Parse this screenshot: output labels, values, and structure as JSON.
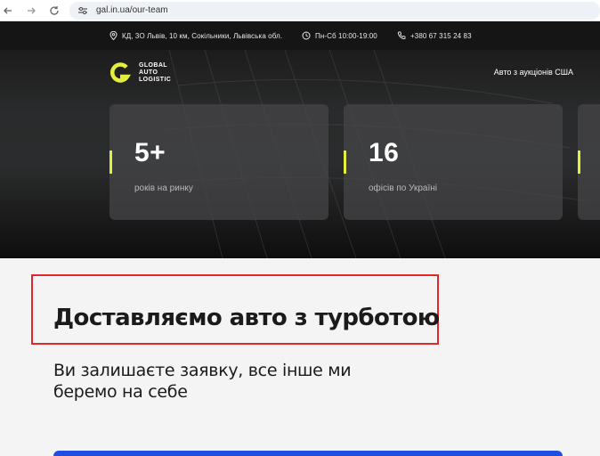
{
  "browser": {
    "url": "gal.in.ua/our-team"
  },
  "topbar": {
    "address": "КД, 3О Львів, 10 км, Сокільники, Львівська обл.",
    "hours": "Пн-Сб 10:00-19:00",
    "phone": "+380 67 315 24 83"
  },
  "header": {
    "logo_letter": "G",
    "logo_lines": [
      "GLOBAL",
      "AUTO",
      "LOGISTIC"
    ],
    "nav_link": "Авто з аукціонів США",
    "accent_color": "#e4ee3c"
  },
  "stats": [
    {
      "value": "5+",
      "label": "років на ринку"
    },
    {
      "value": "16",
      "label": "офісів по Україні"
    }
  ],
  "main": {
    "headline": "Доставляємо авто з турботою",
    "subheadline": "Ви залишаєте заявку, все інше ми беремо на себе",
    "highlight_color": "#e0272a",
    "cta_color": "#1f4fe0"
  }
}
